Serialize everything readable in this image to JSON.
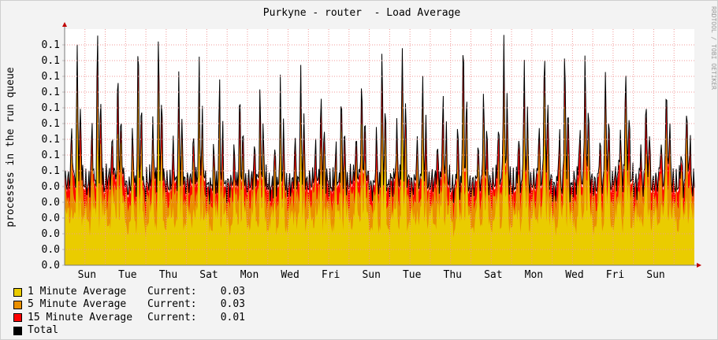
{
  "chart_data": {
    "type": "area",
    "title": "Purkyne - router  - Load Average",
    "ylabel": "processes in the run queue",
    "watermark": "RRDTOOL / TOBI OETIKER",
    "y_tick_labels": [
      "0.0",
      "0.0",
      "0.0",
      "0.0",
      "0.0",
      "0.0",
      "0.1",
      "0.1",
      "0.1",
      "0.1",
      "0.1",
      "0.1",
      "0.1",
      "0.1",
      "0.1"
    ],
    "ylim": [
      0,
      0.14
    ],
    "x_tick_labels": [
      "Sun",
      "Tue",
      "Thu",
      "Sat",
      "Mon",
      "Wed",
      "Fri",
      "Sun",
      "Tue",
      "Thu",
      "Sat",
      "Mon",
      "Wed",
      "Fri",
      "Sun"
    ],
    "x_days": 31,
    "x_start_day_offset": 0.1,
    "grid": true,
    "peak_days": [
      1,
      2,
      3,
      4,
      5,
      6,
      7,
      8,
      9,
      10,
      11,
      12,
      13,
      14,
      15,
      16,
      17,
      18,
      19,
      20,
      21,
      22,
      23,
      24,
      25,
      26,
      27,
      28,
      29,
      30,
      31
    ],
    "peak_values": [
      0.128,
      0.138,
      0.112,
      0.132,
      0.134,
      0.11,
      0.116,
      0.106,
      0.1,
      0.1,
      0.105,
      0.114,
      0.1,
      0.1,
      0.108,
      0.128,
      0.13,
      0.112,
      0.1,
      0.138,
      0.104,
      0.134,
      0.122,
      0.132,
      0.132,
      0.128,
      0.12,
      0.122,
      0.104,
      0.112,
      0.1
    ],
    "baseline_values": [
      0.05,
      0.048,
      0.052,
      0.046,
      0.05,
      0.048,
      0.05,
      0.046,
      0.048,
      0.05,
      0.046,
      0.048,
      0.05,
      0.048,
      0.052,
      0.046,
      0.05,
      0.048,
      0.05,
      0.046,
      0.048,
      0.05,
      0.048,
      0.05,
      0.046,
      0.05,
      0.048,
      0.052,
      0.048,
      0.05,
      0.048
    ],
    "series": [
      {
        "name": "1 Minute Average",
        "color": "#eacc00",
        "current": "0.03"
      },
      {
        "name": "5 Minute Average",
        "color": "#ea8f00",
        "current": "0.03"
      },
      {
        "name": "15 Minute Average",
        "color": "#ff0000",
        "current": "0.01"
      },
      {
        "name": "Total",
        "color": "#000000"
      }
    ]
  },
  "legend": {
    "current_label": "Current:",
    "items": [
      {
        "name": "1 Minute Average",
        "color": "#eacc00",
        "current": "0.03"
      },
      {
        "name": "5 Minute Average",
        "color": "#ea8f00",
        "current": "0.03"
      },
      {
        "name": "15 Minute Average",
        "color": "#ff0000",
        "current": "0.01"
      },
      {
        "name": "Total",
        "color": "#000000"
      }
    ]
  }
}
